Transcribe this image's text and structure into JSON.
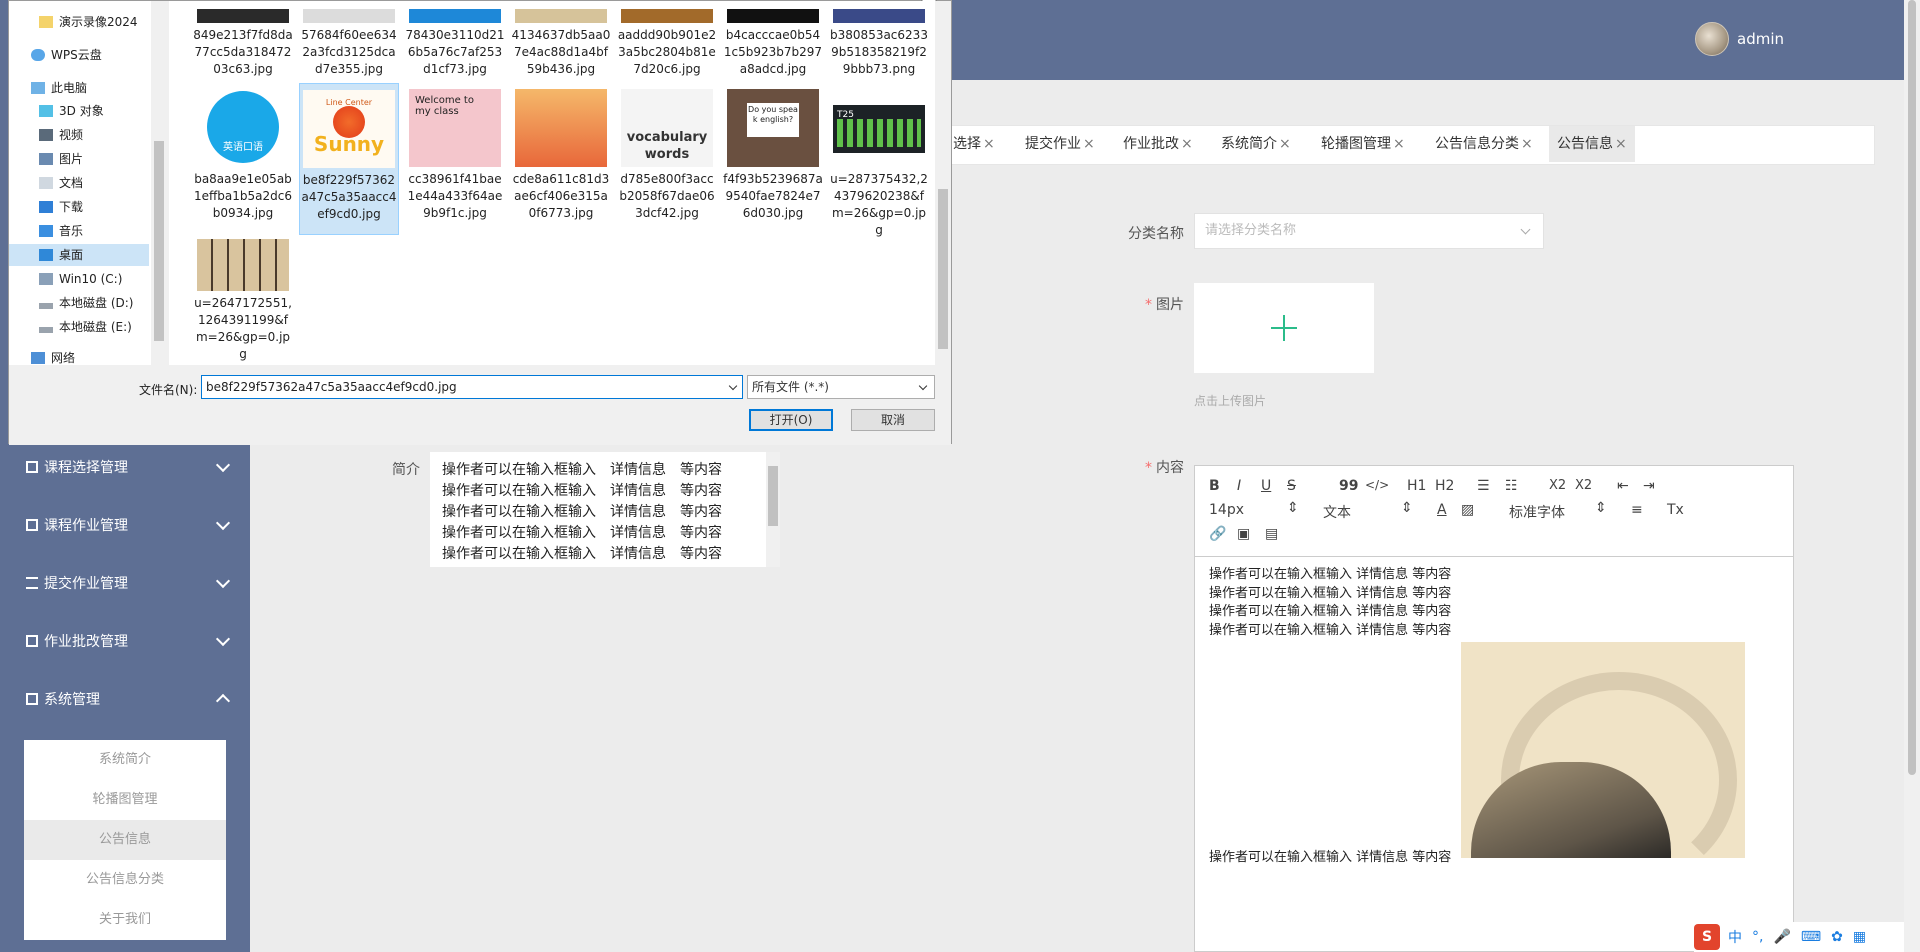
{
  "header": {
    "username": "admin"
  },
  "sidebar": {
    "items": [
      {
        "label": "课程选择管理"
      },
      {
        "label": "课程作业管理"
      },
      {
        "label": "提交作业管理"
      },
      {
        "label": "作业批改管理"
      },
      {
        "label": "系统管理"
      }
    ],
    "submenu": [
      {
        "label": "系统简介"
      },
      {
        "label": "轮播图管理"
      },
      {
        "label": "公告信息"
      },
      {
        "label": "公告信息分类"
      },
      {
        "label": "关于我们"
      }
    ]
  },
  "tabs": [
    {
      "label": "选择"
    },
    {
      "label": "提交作业"
    },
    {
      "label": "作业批改"
    },
    {
      "label": "系统简介"
    },
    {
      "label": "轮播图管理"
    },
    {
      "label": "公告信息分类"
    },
    {
      "label": "公告信息"
    }
  ],
  "form": {
    "category_label": "分类名称",
    "category_placeholder": "请选择分类名称",
    "image_label": "图片",
    "upload_hint": "点击上传图片",
    "content_label": "内容",
    "intro_label": "简介"
  },
  "intro_lines": [
    "操作者可以在输入框输入　详情信息　等内容",
    "操作者可以在输入框输入　详情信息　等内容",
    "操作者可以在输入框输入　详情信息　等内容",
    "操作者可以在输入框输入　详情信息　等内容",
    "操作者可以在输入框输入　详情信息　等内容"
  ],
  "editor": {
    "font_size": "14px",
    "block": "文本",
    "font_family": "标准字体",
    "lines": [
      "操作者可以在输入框输入  详情信息  等内容",
      "操作者可以在输入框输入  详情信息  等内容",
      "操作者可以在输入框输入  详情信息  等内容",
      "操作者可以在输入框输入  详情信息  等内容"
    ],
    "last_line": "操作者可以在输入框输入  详情信息  等内容",
    "toolbar": {
      "b": "B",
      "i": "I",
      "u": "U",
      "s": "S",
      "quote": "99",
      "code": "</>",
      "h1": "H1",
      "h2": "H2",
      "color": "A",
      "sub": "X2",
      "sup": "X2",
      "clear": "Tx"
    }
  },
  "ime": {
    "logo": "S",
    "lang": "中"
  },
  "dialog": {
    "nav": [
      {
        "label": "演示录像2024"
      },
      {
        "label": "WPS云盘"
      },
      {
        "label": "此电脑"
      },
      {
        "label": "3D 对象"
      },
      {
        "label": "视频"
      },
      {
        "label": "图片"
      },
      {
        "label": "文档"
      },
      {
        "label": "下载"
      },
      {
        "label": "音乐"
      },
      {
        "label": "桌面"
      },
      {
        "label": "Win10 (C:)"
      },
      {
        "label": "本地磁盘 (D:)"
      },
      {
        "label": "本地磁盘 (E:)"
      },
      {
        "label": "网络"
      }
    ],
    "files": [
      {
        "name": "849e213f7fd8da77cc5da31847203c63.jpg",
        "color": "#2a2a2a"
      },
      {
        "name": "57684f60ee6342a3fcd3125dcad7e355.jpg",
        "color": "#dcdcdc"
      },
      {
        "name": "78430e3110d216b5a76c7af253d1cf73.jpg",
        "color": "#1e88d8"
      },
      {
        "name": "4134637db5aa07e4ac88d1a4bf59b436.jpg",
        "color": "#d6c39a"
      },
      {
        "name": "aaddd90b901e23a5bc2804b81e7d20c6.jpg",
        "color": "#a26a2a"
      },
      {
        "name": "b4cacccae0b541c5b923b7b297a8adcd.jpg",
        "color": "#111111"
      },
      {
        "name": "b380853ac62339b518358219f29bbb73.png",
        "color": "#3a4a88"
      },
      {
        "name": "ba8aa9e1e05ab1effba1b5a2dc6b0934.jpg",
        "color": "#1aa8e8"
      },
      {
        "name": "be8f229f57362a47c5a35aacc4ef9cd0.jpg",
        "color": "#f6efe6"
      },
      {
        "name": "cc38961f41bae1e44a433f64ae9b9f1c.jpg",
        "color": "#f4c6cc"
      },
      {
        "name": "cde8a611c81d3ae6cf406e315a0f6773.jpg",
        "color": "#e8833a"
      },
      {
        "name": "d785e800f3accb2058f67dae063dcf42.jpg",
        "color": "#7a7a7a"
      },
      {
        "name": "f4f93b5239687a9540fae7824e76d030.jpg",
        "color": "#6a5040"
      },
      {
        "name": "u=287375432,24379620238&fm=26&gp=0.jpg",
        "color": "#1c2226"
      },
      {
        "name": "u=2647172551,1264391199&fm=26&gp=0.jpg",
        "color": "#d9c49e"
      }
    ],
    "thumb_text": {
      "ba8aa": "英语口语",
      "be8f": "Sunny",
      "be8f_top": "Line Center",
      "cc38": "Welcome to my class",
      "d785": "vocabulary words",
      "f4f9": "Do you speak english?",
      "u287": "T25"
    },
    "filename_label": "文件名(N):",
    "filename_value": "be8f229f57362a47c5a35aacc4ef9cd0.jpg",
    "filetype": "所有文件 (*.*)",
    "open_label": "打开(O)",
    "cancel_label": "取消"
  }
}
